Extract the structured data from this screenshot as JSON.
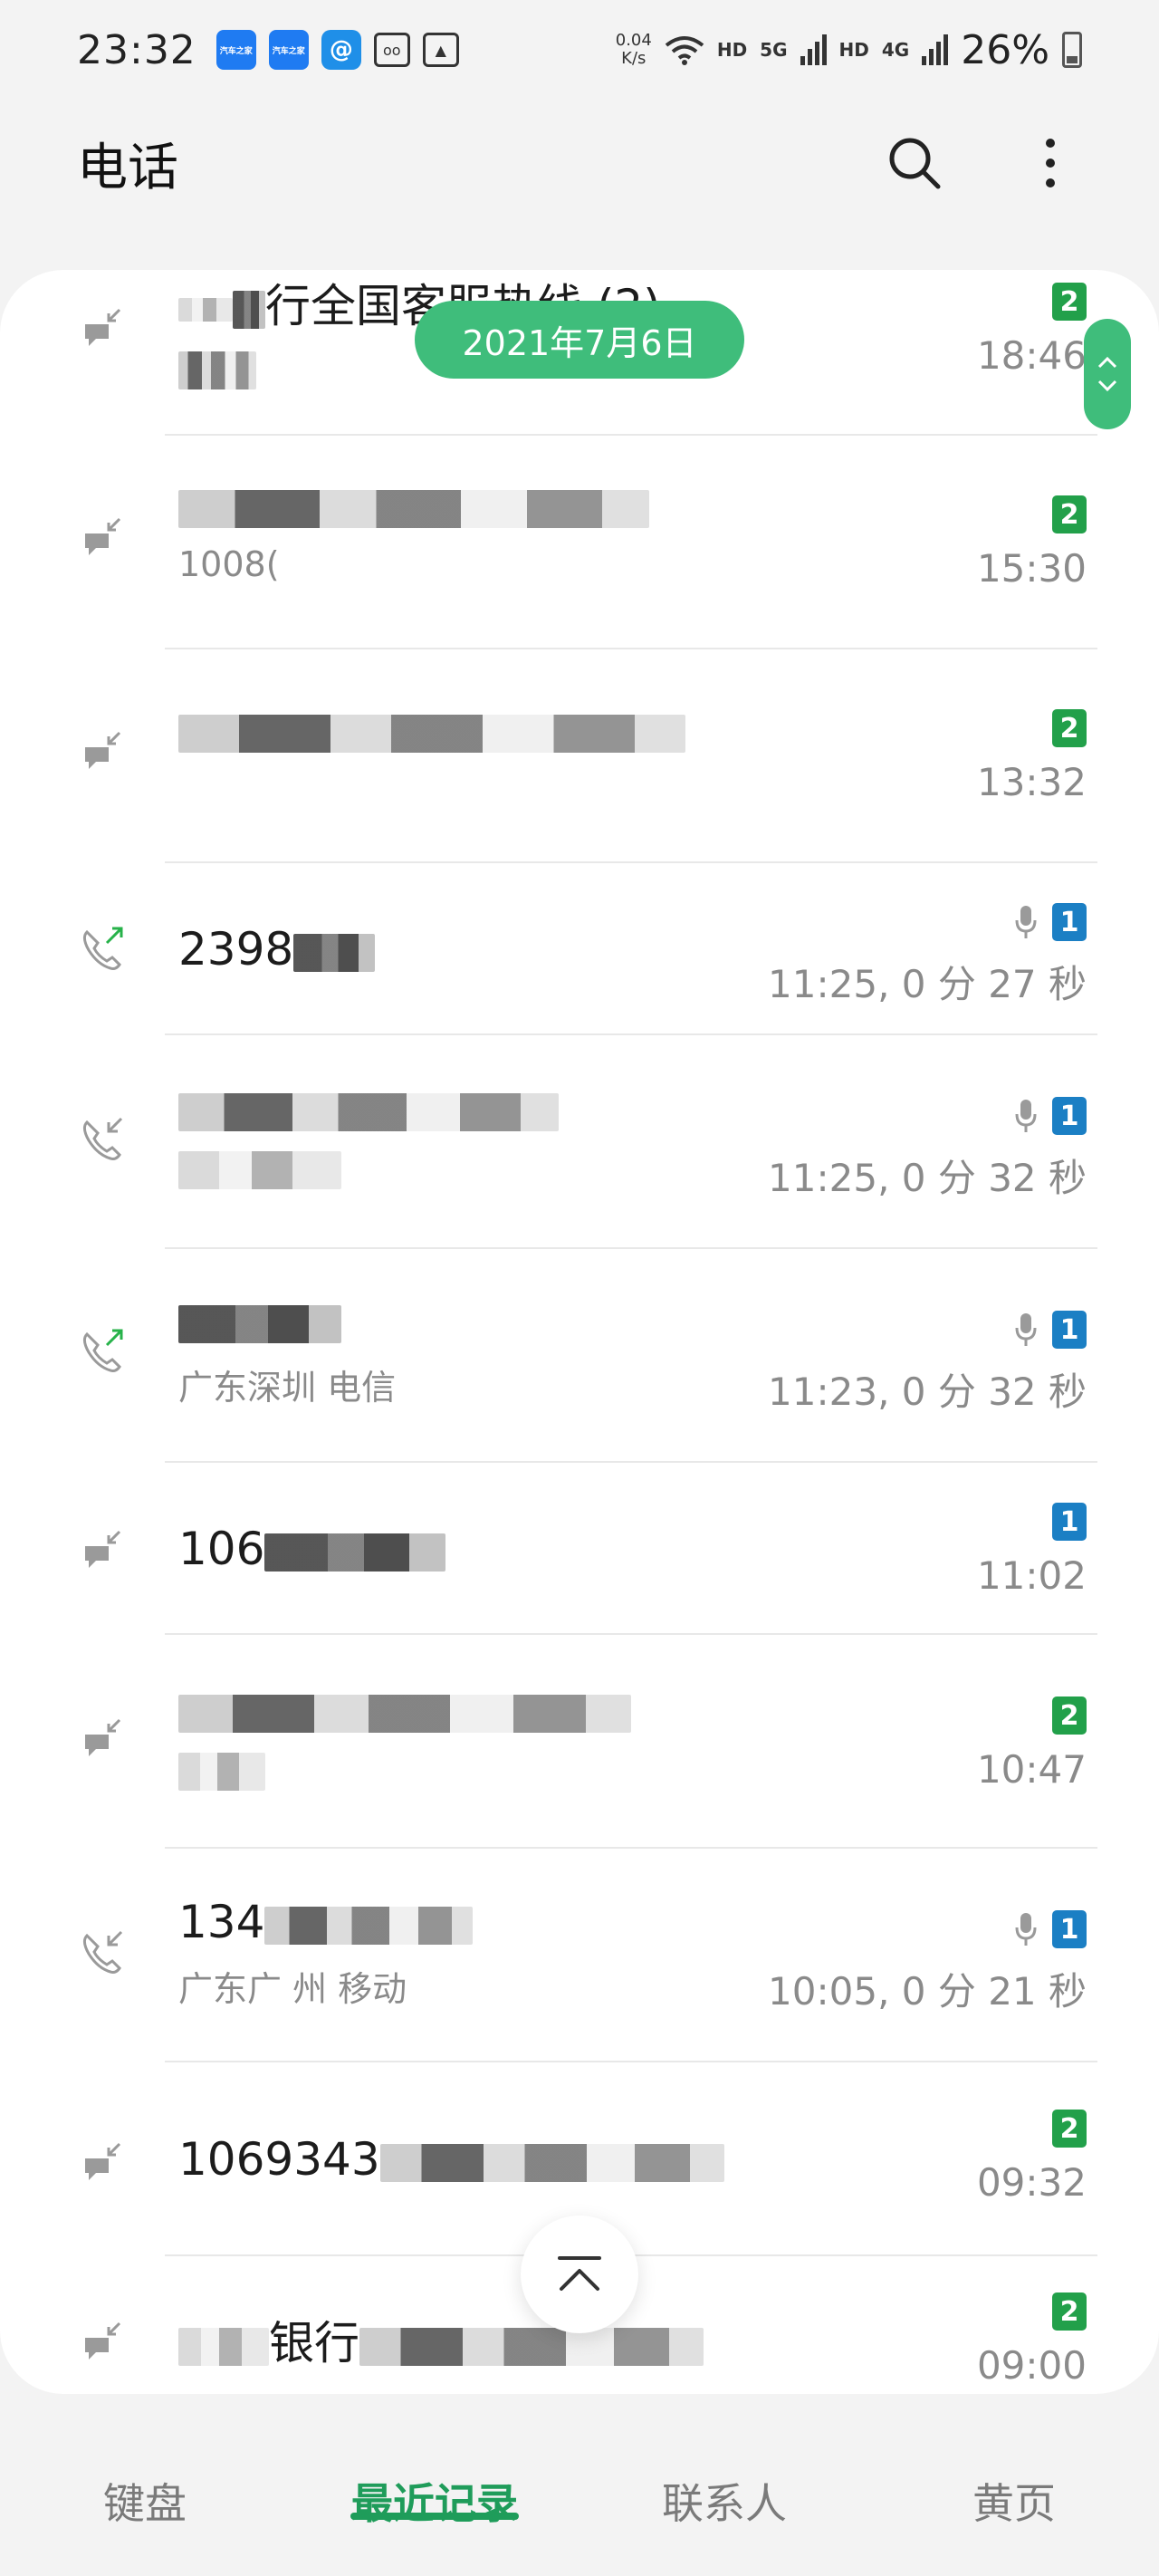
{
  "status_bar": {
    "time": "23:32",
    "notif_app1": "汽车之家",
    "notif_app2": "汽车之家",
    "speed_value": "0.04",
    "speed_unit": "K/s",
    "hd1": "HD",
    "net1": "5G",
    "hd2": "HD",
    "net2": "4G",
    "battery": "26%"
  },
  "header": {
    "title": "电话"
  },
  "date_pill": "2021年7月6日",
  "calls": [
    {
      "title": "行全国客服热线 (2)",
      "subtitle": "",
      "time": "18:46",
      "sim": "2",
      "direction": "incoming-msg",
      "recorded": false
    },
    {
      "title": "",
      "subtitle": "1008(",
      "time": "15:30",
      "sim": "2",
      "direction": "incoming-msg",
      "recorded": false
    },
    {
      "title": "",
      "subtitle": "",
      "time": "13:32",
      "sim": "2",
      "direction": "incoming-msg",
      "recorded": false
    },
    {
      "title": "2398",
      "subtitle": "",
      "time": "11:25, 0 分 27 秒",
      "sim": "1",
      "direction": "outgoing",
      "recorded": true
    },
    {
      "title": "",
      "subtitle": "",
      "time": "11:25, 0 分 32 秒",
      "sim": "1",
      "direction": "incoming",
      "recorded": true
    },
    {
      "title": "",
      "subtitle": "广东深圳 电信",
      "time": "11:23, 0 分 32 秒",
      "sim": "1",
      "direction": "outgoing",
      "recorded": true
    },
    {
      "title": "106",
      "subtitle": "",
      "time": "11:02",
      "sim": "1",
      "direction": "incoming-msg",
      "recorded": false
    },
    {
      "title": "",
      "subtitle": "",
      "time": "10:47",
      "sim": "2",
      "direction": "incoming-msg",
      "recorded": false
    },
    {
      "title": "134",
      "subtitle": "广东广 州 移动",
      "time": "10:05, 0 分 21 秒",
      "sim": "1",
      "direction": "incoming",
      "recorded": true
    },
    {
      "title": "1069343",
      "subtitle": "",
      "time": "09:32",
      "sim": "2",
      "direction": "incoming-msg",
      "recorded": false
    },
    {
      "title": "银行",
      "subtitle": "",
      "time": "09:00",
      "sim": "2",
      "direction": "incoming-msg",
      "recorded": false
    }
  ],
  "tabs": [
    {
      "label": "键盘"
    },
    {
      "label": "最近记录"
    },
    {
      "label": "联系人"
    },
    {
      "label": "黄页"
    }
  ],
  "colors": {
    "accent": "#1f9c5a",
    "pill": "#3fbd7b",
    "sim1": "#1b7fc4",
    "sim2": "#22a04a"
  }
}
